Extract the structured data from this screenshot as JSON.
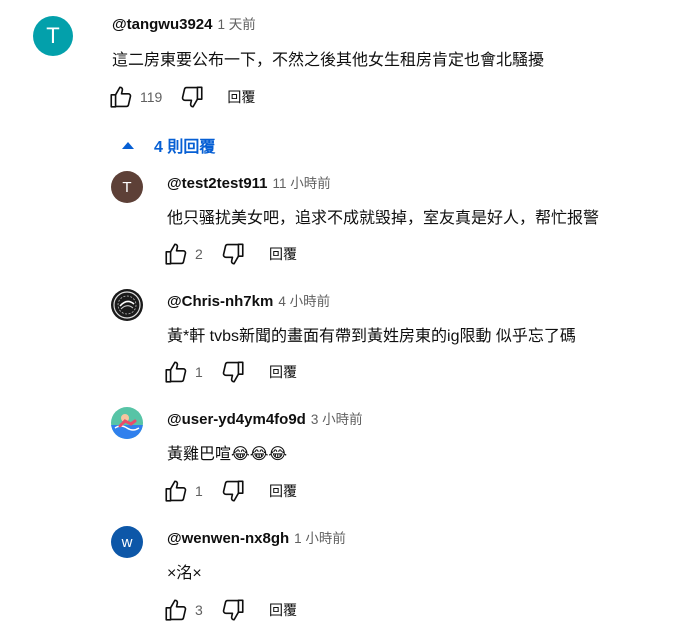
{
  "top_comment": {
    "avatar_letter": "T",
    "avatar_color": "#03a0ab",
    "author": "@tangwu3924",
    "time": "1 天前",
    "text": "這二房東要公布一下，不然之後其他女生租房肯定也會北騷擾",
    "likes": "119",
    "reply_label": "回覆"
  },
  "replies_toggle": {
    "label": "4 則回覆"
  },
  "replies": [
    {
      "avatar_letter": "T",
      "avatar_color": "#5d4037",
      "author": "@test2test911",
      "time": "11 小時前",
      "text": "他只骚扰美女吧，追求不成就毁掉，室友真是好人，帮忙报警",
      "likes": "2",
      "reply_label": "回覆"
    },
    {
      "avatar_letter": "",
      "avatar_color": "#1a1a1a",
      "author": "@Chris-nh7km",
      "time": "4 小時前",
      "text": "黃*軒 tvbs新聞的畫面有帶到黃姓房東的ig限動 似乎忘了碼",
      "likes": "1",
      "reply_label": "回覆"
    },
    {
      "avatar_letter": "",
      "avatar_color": "#57c4a6",
      "author": "@user-yd4ym4fo9d",
      "time": "3 小時前",
      "text": "黃雞巴喧😂😂😂",
      "likes": "1",
      "reply_label": "回覆"
    },
    {
      "avatar_letter": "w",
      "avatar_color": "#0d57a8",
      "author": "@wenwen-nx8gh",
      "time": "1 小時前",
      "text": "×洺×",
      "likes": "3",
      "reply_label": "回覆"
    }
  ]
}
